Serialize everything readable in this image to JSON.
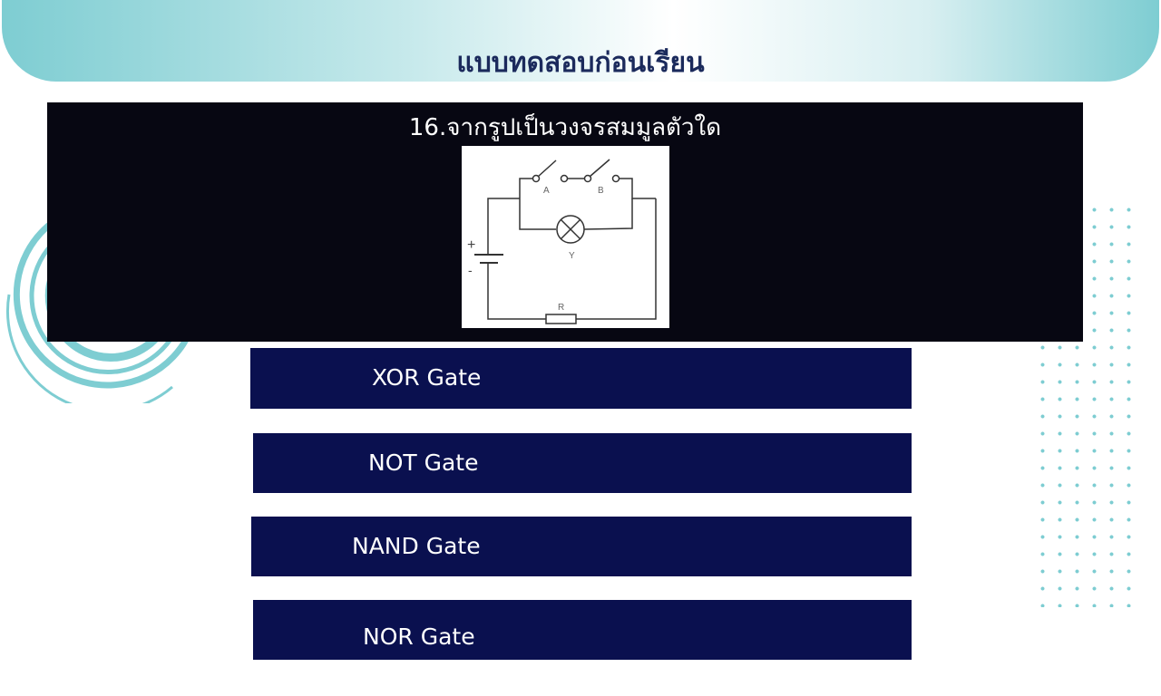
{
  "header": {
    "title": "แบบทดสอบก่อนเรียน"
  },
  "question": {
    "text": "16.จากรูปเป็นวงจรสมมูลตัวใด",
    "figure": {
      "switch_a_label": "A",
      "switch_b_label": "B",
      "lamp_label": "Y",
      "resistor_label": "R",
      "battery_plus": "+",
      "battery_minus": "-"
    }
  },
  "options": [
    {
      "label": "XOR Gate"
    },
    {
      "label": "NOT Gate"
    },
    {
      "label": "NAND Gate"
    },
    {
      "label": "NOR Gate"
    }
  ],
  "colors": {
    "accent_teal": "#7ecdd2",
    "title_navy": "#1b2a5c",
    "question_bg": "#070712",
    "option_bg": "#0a104f"
  }
}
